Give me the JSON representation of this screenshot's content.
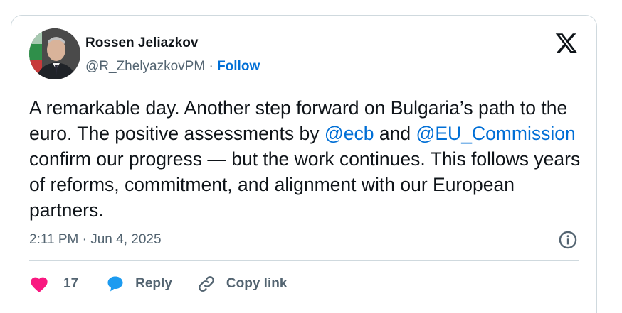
{
  "author": {
    "name": "Rossen Jeliazkov",
    "handle": "@R_ZhelyazkovPM",
    "separator": " · ",
    "follow_label": "Follow",
    "avatar_icon": "profile-photo"
  },
  "tweet": {
    "text_part1": "A remarkable day. Another step forward on Bulgaria’s path to the euro. The positive assessments by ",
    "mention_1": "@ecb",
    "text_part2": " and ",
    "mention_2": "@EU_Commission",
    "text_part3": " confirm our progress — but the work continues. This follows years of reforms, commitment, and alignment with our European partners."
  },
  "meta": {
    "timestamp": "2:11 PM · Jun 4, 2025",
    "info_icon": "info-icon"
  },
  "actions": {
    "like_count": "17",
    "reply_label": "Reply",
    "copy_link_label": "Copy link"
  },
  "colors": {
    "link_blue": "#006fd6",
    "like_pink": "#f91880",
    "reply_blue": "#1d9bf0",
    "secondary_text": "#536471",
    "border": "#cfd9de"
  },
  "brand_icon": "x-logo"
}
